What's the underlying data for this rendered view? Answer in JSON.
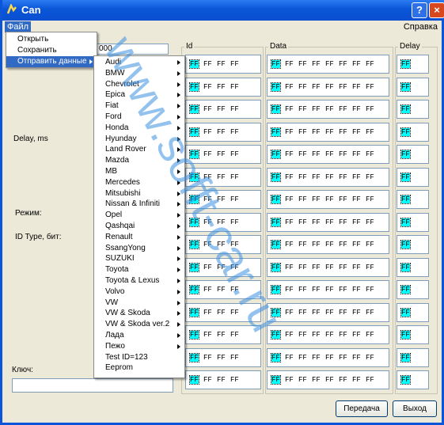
{
  "window": {
    "title": "Can",
    "help_button": "?",
    "close_button": "×"
  },
  "menubar": {
    "file": "Файл",
    "help": "Справка"
  },
  "file_menu": [
    "Открыть",
    "Сохранить",
    "Отправить данные"
  ],
  "submenu": [
    "Audi",
    "BMW",
    "Chevrolet",
    "Epica",
    "Fiat",
    "Ford",
    "Honda",
    "Hyunday",
    "Land Rover",
    "Mazda",
    "MB",
    "Mercedes",
    "Mitsubishi",
    "Nissan & Infiniti",
    "Opel",
    "Qashqai",
    "Renault",
    "SsangYong",
    "SUZUKI",
    "Toyota",
    "Toyota & Lexus",
    "Volvo",
    "VW",
    "VW & Skoda",
    "VW & Skoda ver.2",
    "Лада",
    "Пежо",
    "Test ID=123",
    "Eeprom"
  ],
  "submenu_no_arrow": [
    "Test ID=123",
    "Eeprom"
  ],
  "left_panel": {
    "top_field_value": "000",
    "delay_label": "Delay, ms",
    "mode_label": "Режим:",
    "id_type_label": "ID Type, бит:",
    "key_label": "Ключ:"
  },
  "columns": {
    "id": "Id",
    "data": "Data",
    "delay": "Delay"
  },
  "byte": "FF",
  "row_count": 15,
  "buttons": {
    "send": "Передача",
    "exit": "Выход"
  },
  "watermark": "www.sofft-car.ru",
  "colors": {
    "titlebar": "#0a55d8",
    "highlight": "#00ffff",
    "menu_selected": "#316ac5"
  }
}
